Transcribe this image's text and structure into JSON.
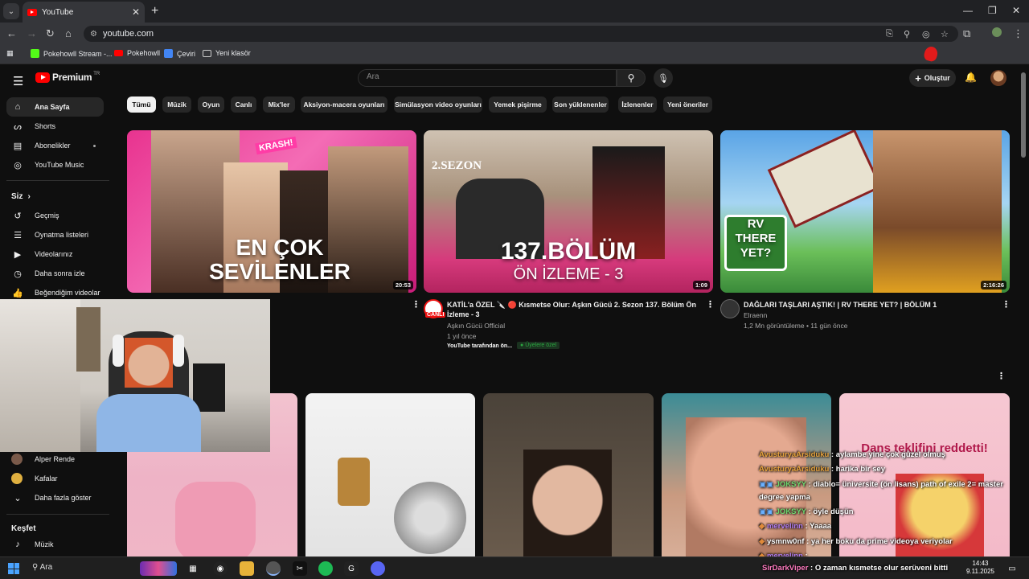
{
  "browser": {
    "tab_title": "YouTube",
    "url": "youtube.com",
    "bookmarks": [
      "Pokehowll Stream -...",
      "Pokehowll",
      "Çeviri",
      "Yeni klasör"
    ]
  },
  "header": {
    "logo_text": "Premium",
    "logo_region": "TR",
    "search_placeholder": "Ara",
    "create_label": "Oluştur"
  },
  "sidebar": {
    "items": [
      {
        "label": "Ana Sayfa",
        "icon": "home-icon"
      },
      {
        "label": "Shorts",
        "icon": "shorts-icon"
      },
      {
        "label": "Abonelikler",
        "icon": "subscriptions-icon"
      },
      {
        "label": "YouTube Music",
        "icon": "youtube-music-icon"
      }
    ],
    "you_heading": "Siz",
    "you_items": [
      {
        "label": "Geçmiş",
        "icon": "history-icon"
      },
      {
        "label": "Oynatma listeleri",
        "icon": "playlists-icon"
      },
      {
        "label": "Videolarınız",
        "icon": "your-videos-icon"
      },
      {
        "label": "Daha sonra izle",
        "icon": "watch-later-icon"
      },
      {
        "label": "Beğendiğim videolar",
        "icon": "liked-videos-icon"
      }
    ],
    "subscriptions": [
      {
        "label": "Alper Rende"
      },
      {
        "label": "Kafalar"
      }
    ],
    "show_more": "Daha fazla göster",
    "explore_heading": "Keşfet",
    "explore_items": [
      {
        "label": "Müzik",
        "icon": "music-icon"
      }
    ]
  },
  "chips": [
    "Tümü",
    "Müzik",
    "Oyun",
    "Canlı",
    "Mix'ler",
    "Aksiyon-macera oyunları",
    "Simülasyon video oyunları",
    "Yemek pişirme",
    "Son yüklenenler",
    "İzlenenler",
    "Yeni öneriler"
  ],
  "videos": [
    {
      "thumb_text_1": "EN ÇOK",
      "thumb_text_2": "SEVİLENLER",
      "thumb_badge": "KRASH!",
      "duration": "20:53"
    },
    {
      "thumb_text_1": "137.BÖLÜM",
      "thumb_text_2": "ÖN İZLEME - 3",
      "thumb_badge": "2.SEZON",
      "duration": "1:09",
      "title_line1": "KATİL'a ÖZEL 🔪 🔴 Kısmetse Olur: Aşkın Gücü 2. Sezon 137. Bölüm Ön",
      "title_line2": "İzleme - 3",
      "channel": "Aşkın Gücü Official",
      "age": "1 yıl önce",
      "source": "YouTube tarafından ön...",
      "members": "Üyelere özel",
      "live_badge": "CANLI"
    },
    {
      "thumb_text_1": "RV",
      "thumb_text_2": "THERE",
      "thumb_text_3": "YET?",
      "duration": "2:16:26",
      "title": "DAĞLARI TAŞLARI AŞTIK! | RV THERE YET? | BÖLÜM 1",
      "channel": "Elraenn",
      "meta": "1,2 Mn görüntüleme • 11 gün önce"
    }
  ],
  "shorts": [
    {
      "overlay": ""
    },
    {
      "overlay": ""
    },
    {
      "overlay": ""
    },
    {
      "overlay": ""
    },
    {
      "overlay": "Dans teklifini reddetti!"
    }
  ],
  "chat": [
    {
      "user": "AvusturyaArsiduku",
      "msg": ": aylambe yine çok güzel olmuş",
      "color": "orange"
    },
    {
      "user": "AvusturyaArsiduku",
      "msg": ": harika bir sey",
      "color": "orange"
    },
    {
      "user": "JOKSYY",
      "msg": ": diablo= üniversite (ön lisans) path of exile 2= master",
      "color": "green"
    },
    {
      "user": "",
      "msg": "degree yapma",
      "color": "none"
    },
    {
      "user": "JOKSYY",
      "msg": ": öyle düşün",
      "color": "green"
    },
    {
      "user": "mervelinn",
      "msg": ": Yaaaa",
      "color": "purple"
    },
    {
      "user": "ysmnw0nf",
      "msg": ": ya her boku da prime videoya veriyolar",
      "color": "none"
    },
    {
      "user": "mervelinn",
      "msg": ":",
      "color": "purple"
    },
    {
      "user": "SirDarkViper",
      "msg": ": O zaman kısmetse olur serüveni bitti",
      "color": "pink"
    }
  ],
  "taskbar": {
    "search": "Ara",
    "time": "14:43",
    "date": "9.11.2025"
  },
  "colors": {
    "bg": "#0f0f0f",
    "accent": "#ff0000",
    "chip": "#272727"
  }
}
